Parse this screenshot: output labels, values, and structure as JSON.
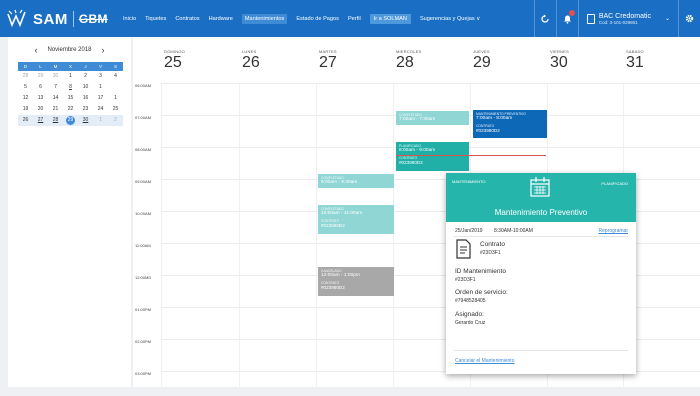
{
  "header": {
    "logo_text": "SAM",
    "logo_partner": "GBM",
    "nav": [
      "Inicio",
      "Tiquetes",
      "Contratos",
      "Hardware",
      "Mantenimientos",
      "Estado de Pagos",
      "Perfil",
      "Ir a SOLMAN",
      "Sugerencias y Quejas ∨"
    ],
    "account_name": "BAC Credomatic",
    "account_sub": "Cod: 3-101-029861"
  },
  "mini_calendar": {
    "month_label": "Noviembre 2018",
    "weekdays": [
      "D",
      "L",
      "M",
      "X",
      "J",
      "V",
      "S"
    ],
    "weeks": [
      [
        "28",
        "29",
        "30",
        "1",
        "2",
        "3",
        "4"
      ],
      [
        "5",
        "6",
        "7",
        "8",
        "10",
        "1",
        ""
      ],
      [
        "12",
        "13",
        "14",
        "15",
        "16",
        "17",
        "1"
      ],
      [
        "19",
        "20",
        "21",
        "22",
        "23",
        "24",
        "25"
      ],
      [
        "26",
        "27",
        "28",
        "29",
        "30",
        "1",
        "2"
      ]
    ],
    "extra_marks": [
      "1",
      "8"
    ]
  },
  "week": {
    "days": [
      {
        "name": "DOMINGO",
        "num": "25"
      },
      {
        "name": "LUNES",
        "num": "26"
      },
      {
        "name": "MARTES",
        "num": "27"
      },
      {
        "name": "MIERCOLES",
        "num": "28"
      },
      {
        "name": "JUEVES",
        "num": "29"
      },
      {
        "name": "VIERNES",
        "num": "30"
      },
      {
        "name": "SABADO",
        "num": "31"
      }
    ],
    "times": [
      "06:00AM",
      "07:00AM",
      "08:00AM",
      "09:00AM",
      "10:00AM",
      "11:00AM",
      "12:00MD",
      "01:00PM",
      "02:00PM",
      "03:00PM"
    ]
  },
  "events": [
    {
      "status": "COMPLETADO",
      "time": "7:00am - 7:30am",
      "contract_label": "",
      "contract": ""
    },
    {
      "status": "MANTENIMIENTO PREVENTIVO",
      "time": "7:00am - 8:00am",
      "contract_label": "CONTRATO",
      "contract": "#023980D2"
    },
    {
      "status": "PLANIFICADO",
      "time": "8:00am - 9:00am",
      "contract_label": "CONTRATO",
      "contract": "#023980D2"
    },
    {
      "status": "COMPLETADO",
      "time": "9:00am - 9:30am",
      "contract_label": "",
      "contract": ""
    },
    {
      "status": "COMPLETADO",
      "time": "10:00am - 11:00am",
      "contract_label": "CONTRATO",
      "contract": "#023980D2"
    },
    {
      "status": "CANCELADO",
      "time": "12:00am - 1:00pm",
      "contract_label": "CONTRATO",
      "contract": "#023980D2"
    }
  ],
  "popup": {
    "type_label": "MANTENIMIENTO",
    "status_label": "PLANIFICADO",
    "title": "Mantenimiento Preventivo",
    "date": "25/Jan/2019",
    "time": "8:30AM-10:00AM",
    "reschedule": "Reprogramar",
    "contract_label": "Contrato",
    "contract_id": "#23D3F1",
    "maint_label": "ID Mantenimiento",
    "maint_id": "#23D3F1",
    "order_label": "Orden de servicio:",
    "order_id": "#7948528405",
    "assigned_label": "Asignado:",
    "assigned_name": "Gerardo Cruz",
    "cancel": "Cancelar el Mantenimiento"
  },
  "colors": {
    "nav": "#1a6fc4",
    "teal": "#21b0a8",
    "light_teal": "#8fd6d4",
    "navy": "#0e68b8",
    "gray": "#a8a8a8"
  }
}
